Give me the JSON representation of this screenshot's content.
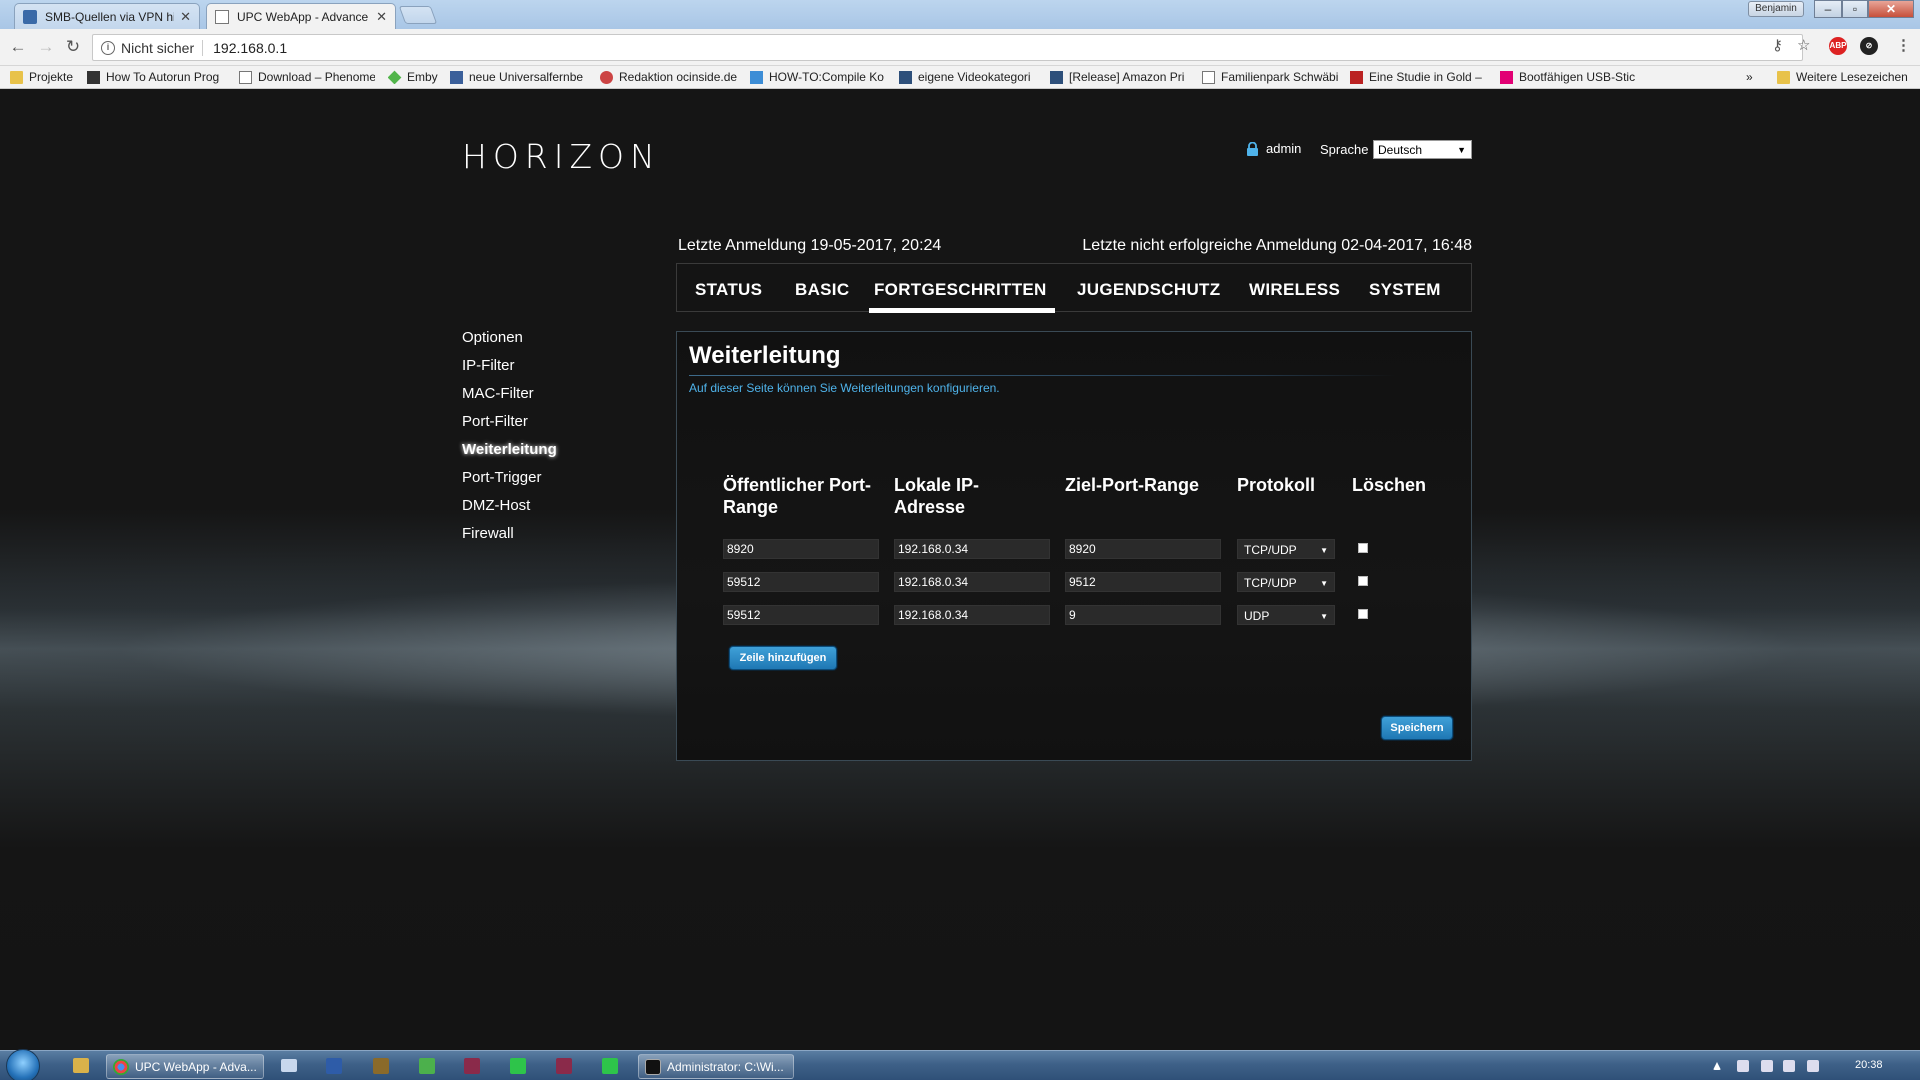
{
  "browser": {
    "tabs": [
      {
        "label": "SMB-Quellen via VPN hi",
        "close": "✕"
      },
      {
        "label": "UPC WebApp - Advance",
        "close": "✕"
      }
    ],
    "user_badge": "Benjamin",
    "window_buttons": {
      "minimize": "–",
      "maximize": "▫",
      "close": "✕"
    },
    "address": {
      "security": "Nicht sicher",
      "url": "192.168.0.1"
    }
  },
  "bookmarks": [
    "Projekte",
    "How To Autorun Prog",
    "Download – Phenome",
    "Emby",
    "neue Universalfernbe",
    "Redaktion ocinside.de",
    "HOW-TO:Compile Ko",
    "eigene Videokategori",
    "[Release] Amazon Pri",
    "Familienpark Schwäbi",
    "Eine Studie in Gold –",
    "Bootfähigen USB-Stic"
  ],
  "bookmarks_more": "»",
  "bookmarks_other": "Weitere Lesezeichen",
  "header": {
    "logo": "HORIZON",
    "user": "admin",
    "language_label": "Sprache",
    "language_value": "Deutsch",
    "last_login": "Letzte Anmeldung 19-05-2017, 20:24",
    "last_failed_login": "Letzte nicht erfolgreiche Anmeldung 02-04-2017, 16:48"
  },
  "nav": {
    "tabs": [
      "STATUS",
      "BASIC",
      "FORTGESCHRITTEN",
      "JUGENDSCHUTZ",
      "WIRELESS",
      "SYSTEM"
    ],
    "active": "FORTGESCHRITTEN"
  },
  "sidebar": {
    "items": [
      "Optionen",
      "IP-Filter",
      "MAC-Filter",
      "Port-Filter",
      "Weiterleitung",
      "Port-Trigger",
      "DMZ-Host",
      "Firewall"
    ],
    "active": "Weiterleitung"
  },
  "panel": {
    "title": "Weiterleitung",
    "description": "Auf dieser Seite können Sie Weiterleitungen konfigurieren.",
    "columns": {
      "public_port": [
        "Öffentlicher Port-",
        "Range"
      ],
      "local_ip": [
        "Lokale IP-",
        "Adresse"
      ],
      "target_port": "Ziel-Port-Range",
      "protocol": "Protokoll",
      "delete": "Löschen"
    },
    "rows": [
      {
        "public_port": "8920",
        "local_ip": "192.168.0.34",
        "target_port": "8920",
        "protocol": "TCP/UDP"
      },
      {
        "public_port": "59512",
        "local_ip": "192.168.0.34",
        "target_port": "9512",
        "protocol": "TCP/UDP"
      },
      {
        "public_port": "59512",
        "local_ip": "192.168.0.34",
        "target_port": "9",
        "protocol": "UDP"
      }
    ],
    "add_row_label": "Zeile hinzufügen",
    "save_label": "Speichern"
  },
  "taskbar": {
    "buttons": [
      "UPC WebApp - Adva...",
      "Administrator: C:\\Wi..."
    ],
    "clock": "20:38"
  },
  "colors": {
    "accent_blue": "#4fb3ea",
    "button_blue": "#2a8cc8",
    "page_bg": "#141414"
  }
}
